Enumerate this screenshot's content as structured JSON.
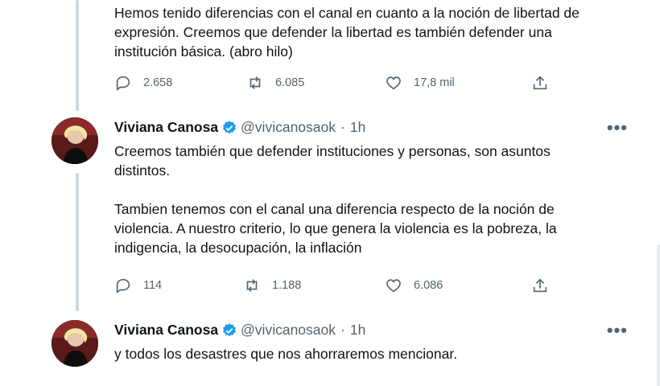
{
  "tweets": [
    {
      "text": "Hemos tenido diferencias con el canal en cuanto a la noción de libertad de\nexpresión. Creemos que defender la libertad es también defender una\ninstitución básica. (abro hilo)",
      "replies": "2.658",
      "retweets": "6.085",
      "likes": "17,8 mil"
    },
    {
      "name": "Viviana Canosa",
      "handle": "@vivicanosaok",
      "sep": "·",
      "time": "1h",
      "more": "•••",
      "text": "Creemos también que defender instituciones y  personas, son asuntos\ndistintos.\n\nTambien tenemos con el canal una diferencia respecto de la noción de\nviolencia. A nuestro criterio, lo que genera la violencia es la pobreza, la\nindigencia, la desocupación, la inflación",
      "replies": "114",
      "retweets": "1.188",
      "likes": "6.086"
    },
    {
      "name": "Viviana Canosa",
      "handle": "@vivicanosaok",
      "sep": "·",
      "time": "1h",
      "more": "•••",
      "text": "y todos los desastres que nos ahorraremos mencionar."
    }
  ],
  "icons": {
    "reply": "reply-icon",
    "retweet": "retweet-icon",
    "like": "heart-icon",
    "share": "share-icon",
    "verified": "verified-badge-icon"
  },
  "colors": {
    "verified": "#1d9bf0",
    "muted": "#536471",
    "thread": "#cfd9de"
  }
}
